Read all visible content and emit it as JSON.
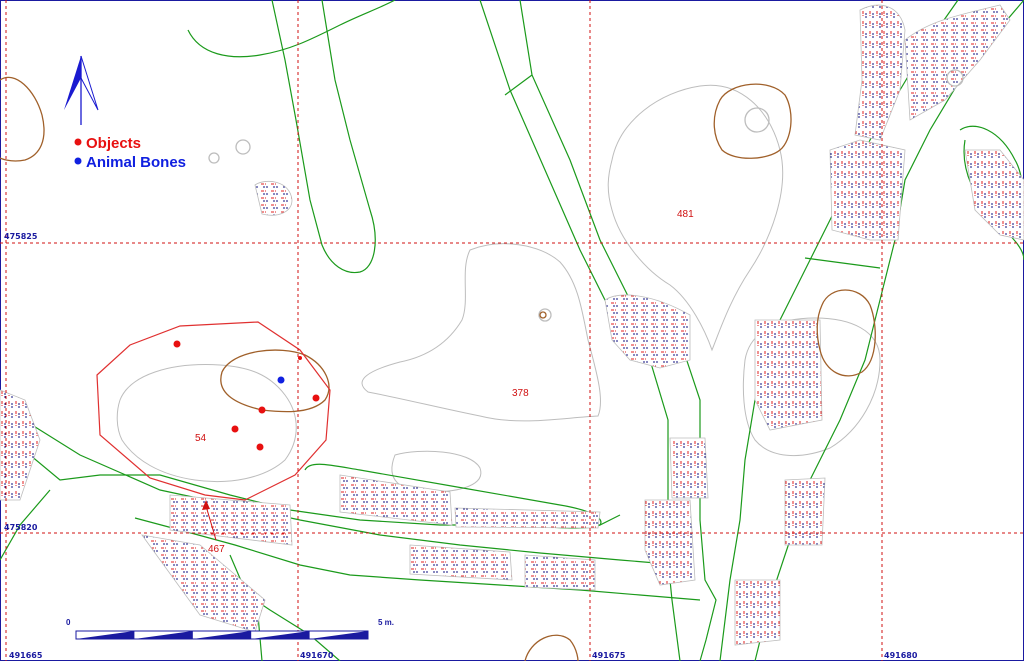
{
  "colors": {
    "grid": "#d01010",
    "coord": "#1a1aa0",
    "trench": "#1b9a1b",
    "pit": "#a0602a",
    "soil": "#bdbdbd",
    "feature_outline": "#e03030",
    "hatch_red": "#e02020",
    "hatch_blue": "#101080",
    "object_point": "#e81010",
    "bone_point": "#1020e0",
    "north_arrow": "#1a1ad0",
    "frame": "#1a1aa0"
  },
  "legend": {
    "items": [
      {
        "label": "Objects",
        "color": "#e81010"
      },
      {
        "label": "Animal Bones",
        "color": "#1020e0"
      }
    ]
  },
  "grid": {
    "y_labels": [
      "475825",
      "475820"
    ],
    "x_labels": [
      "491665",
      "491670",
      "491675",
      "491680"
    ]
  },
  "features": {
    "f481": "481",
    "f378": "378",
    "f54": "54",
    "f467": "467"
  },
  "scale_bar": {
    "start_label": "0",
    "end_label": "5 m.",
    "segments": 5
  },
  "points": {
    "objects": 6,
    "animal_bones": 1
  }
}
